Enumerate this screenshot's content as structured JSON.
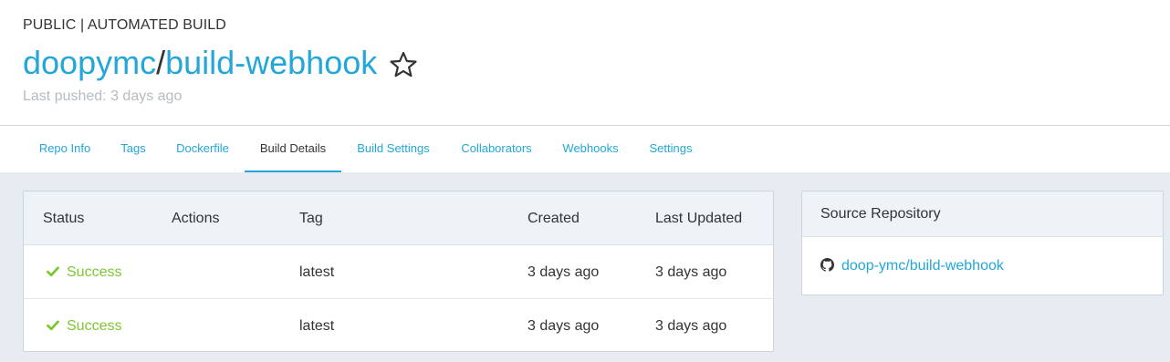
{
  "header": {
    "repo_type": "PUBLIC | AUTOMATED BUILD",
    "namespace": "doopymc",
    "separator": "/",
    "repo_name": "build-webhook",
    "last_pushed": "Last pushed: 3 days ago",
    "star_icon": "star-outline-icon"
  },
  "tabs": [
    {
      "label": "Repo Info"
    },
    {
      "label": "Tags"
    },
    {
      "label": "Dockerfile"
    },
    {
      "label": "Build Details",
      "active": true
    },
    {
      "label": "Build Settings"
    },
    {
      "label": "Collaborators"
    },
    {
      "label": "Webhooks"
    },
    {
      "label": "Settings"
    }
  ],
  "builds_table": {
    "columns": [
      "Status",
      "Actions",
      "Tag",
      "Created",
      "Last Updated"
    ],
    "rows": [
      {
        "status": "Success",
        "actions": "",
        "tag": "latest",
        "created": "3 days ago",
        "last_updated": "3 days ago"
      },
      {
        "status": "Success",
        "actions": "",
        "tag": "latest",
        "created": "3 days ago",
        "last_updated": "3 days ago"
      }
    ],
    "status_icon": "check-icon"
  },
  "source_repository": {
    "title": "Source Repository",
    "link": "doop-ymc/build-webhook",
    "icon": "github-icon"
  },
  "colors": {
    "link": "#22a7d8",
    "success": "#7dc832",
    "page_background": "#e7ecf2",
    "panel_header": "#eef3f8",
    "muted_text": "#b6bcc2"
  }
}
